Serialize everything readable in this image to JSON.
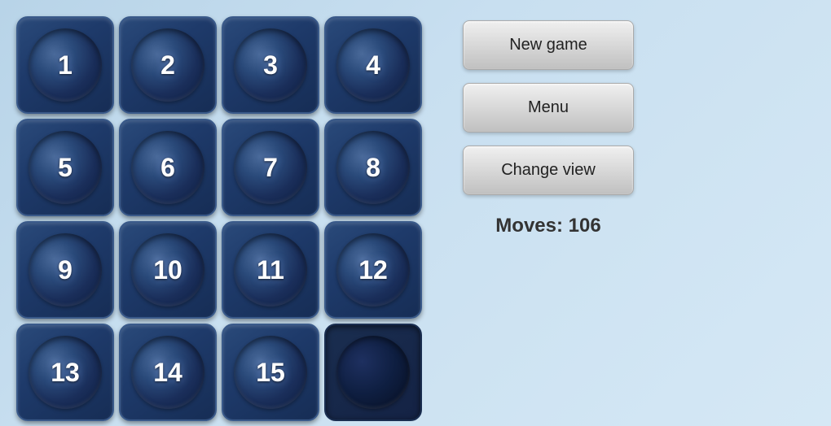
{
  "buttons": {
    "new_game": "New game",
    "menu": "Menu",
    "change_view": "Change view"
  },
  "moves": {
    "label": "Moves: 106"
  },
  "tiles": [
    {
      "number": "1",
      "empty": false
    },
    {
      "number": "2",
      "empty": false
    },
    {
      "number": "3",
      "empty": false
    },
    {
      "number": "4",
      "empty": false
    },
    {
      "number": "5",
      "empty": false
    },
    {
      "number": "6",
      "empty": false
    },
    {
      "number": "7",
      "empty": false
    },
    {
      "number": "8",
      "empty": false
    },
    {
      "number": "9",
      "empty": false
    },
    {
      "number": "10",
      "empty": false
    },
    {
      "number": "11",
      "empty": false
    },
    {
      "number": "12",
      "empty": false
    },
    {
      "number": "13",
      "empty": false
    },
    {
      "number": "14",
      "empty": false
    },
    {
      "number": "15",
      "empty": false
    },
    {
      "number": "",
      "empty": true
    }
  ]
}
